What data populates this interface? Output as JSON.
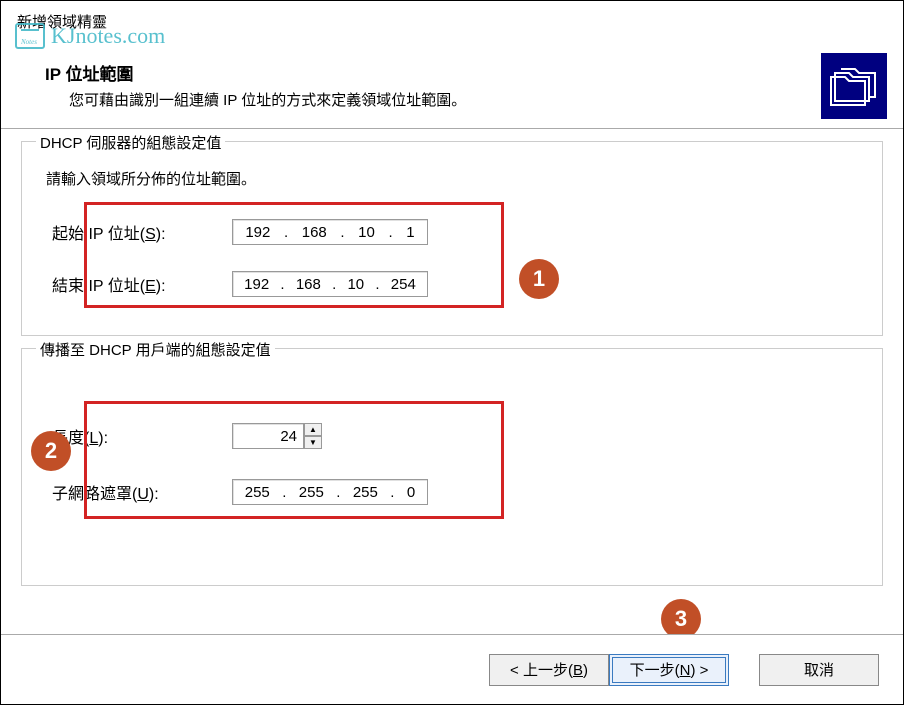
{
  "window": {
    "title": "新增領域精靈"
  },
  "watermark": {
    "text": "KJnotes.com"
  },
  "header": {
    "section_title": "IP 位址範圍",
    "section_desc": "您可藉由識別一組連續 IP 位址的方式來定義領域位址範圍。"
  },
  "group1": {
    "legend": "DHCP 伺服器的組態設定值",
    "intro": "請輸入領域所分佈的位址範圍。",
    "start_label_pre": "起始 IP 位址(",
    "start_label_u": "S",
    "start_label_post": "):",
    "end_label_pre": "結束 IP 位址(",
    "end_label_u": "E",
    "end_label_post": "):",
    "start_ip": {
      "o1": "192",
      "o2": "168",
      "o3": "10",
      "o4": "1"
    },
    "end_ip": {
      "o1": "192",
      "o2": "168",
      "o3": "10",
      "o4": "254"
    }
  },
  "group2": {
    "legend": "傳播至 DHCP 用戶端的組態設定值",
    "length_label_pre": "長度(",
    "length_label_u": "L",
    "length_label_post": "):",
    "length_value": "24",
    "mask_label_pre": "子網路遮罩(",
    "mask_label_u": "U",
    "mask_label_post": "):",
    "mask": {
      "o1": "255",
      "o2": "255",
      "o3": "255",
      "o4": "0"
    }
  },
  "footer": {
    "back_pre": "< 上一步(",
    "back_u": "B",
    "back_post": ")",
    "next_pre": "下一步(",
    "next_u": "N",
    "next_post": ") >",
    "cancel": "取消"
  },
  "annotations": {
    "b1": "1",
    "b2": "2",
    "b3": "3"
  }
}
